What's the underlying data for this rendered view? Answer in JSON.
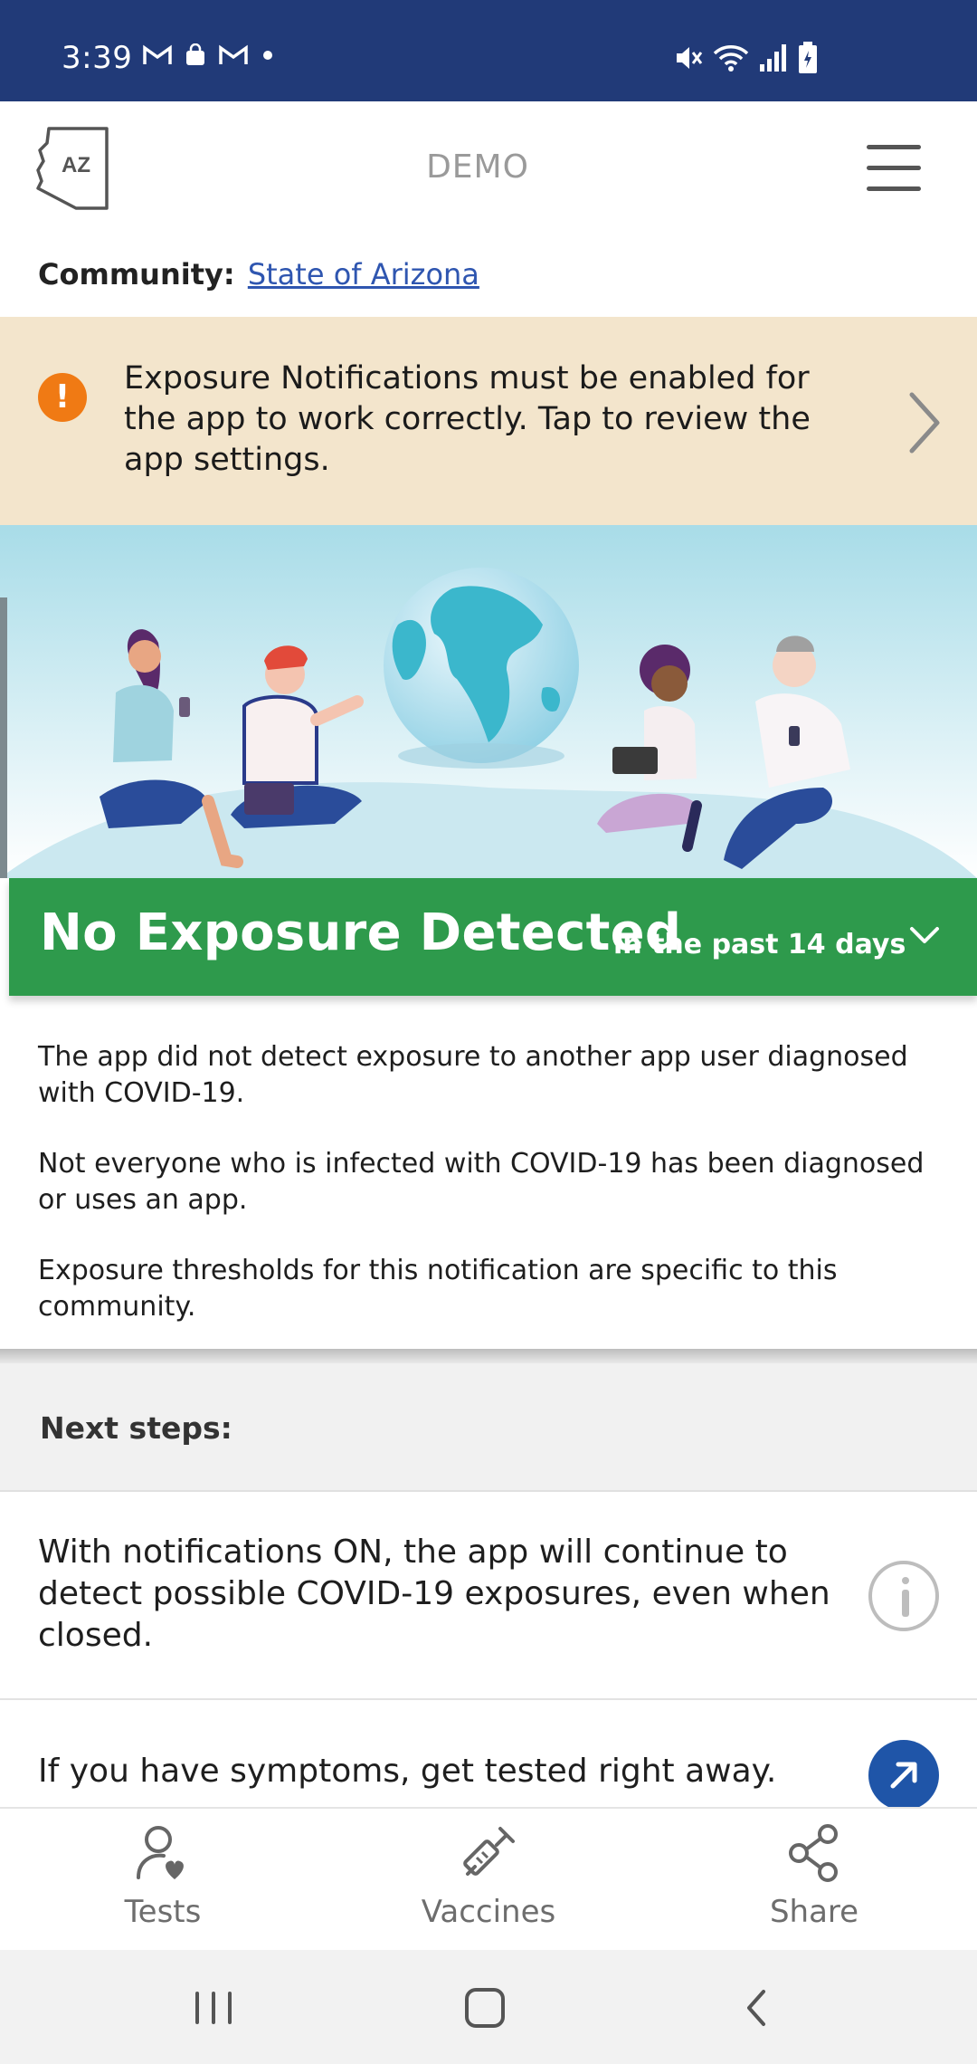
{
  "status_bar": {
    "time": "3:39",
    "left_icons": [
      "gmail-icon",
      "bag-icon",
      "gmail-icon",
      "dot-icon"
    ],
    "right_icons": [
      "mute-icon",
      "wifi-icon",
      "signal-icon",
      "battery-icon"
    ]
  },
  "header": {
    "logo_text": "AZ",
    "title": "DEMO",
    "menu_icon": "hamburger-menu-icon"
  },
  "community": {
    "label": "Community:",
    "name": "State of Arizona"
  },
  "banner": {
    "icon": "!",
    "text": "Exposure Notifications must be enabled for the app to work correctly. Tap to review the app settings."
  },
  "exposure_status": {
    "headline": "No Exposure Detected",
    "qualifier": "in the past 14 days",
    "color": "#2e9a4c"
  },
  "description": {
    "paragraphs": [
      "The app did not detect exposure to another app user diagnosed with COVID-19.",
      "Not everyone who is infected with COVID-19 has been diagnosed or uses an app.",
      "Exposure thresholds for this notification are specific to this community."
    ]
  },
  "next_steps": {
    "title": "Next steps:",
    "items": [
      {
        "text": "With notifications ON, the app will continue to detect possible COVID-19 exposures, even when closed.",
        "icon": "info-icon"
      },
      {
        "text": "If you have symptoms, get tested right away.",
        "icon": "external-arrow-icon"
      }
    ]
  },
  "tabs": [
    {
      "label": "Tests",
      "icon": "person-heart-icon"
    },
    {
      "label": "Vaccines",
      "icon": "syringe-icon"
    },
    {
      "label": "Share",
      "icon": "share-icon"
    }
  ],
  "colors": {
    "status_bar": "#213a78",
    "banner_bg": "#f3e5cc",
    "warning": "#f07a14",
    "link": "#2f56b0",
    "accent_blue": "#1f55a8"
  }
}
